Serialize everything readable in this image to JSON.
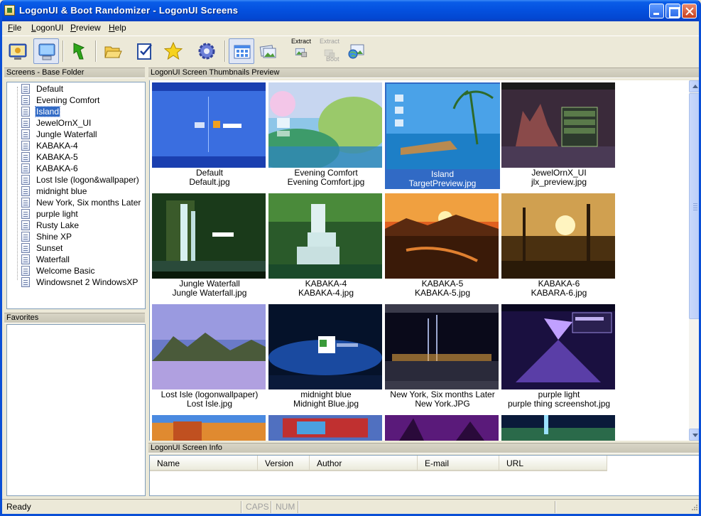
{
  "window": {
    "title": "LogonUI & Boot Randomizer - LogonUI Screens"
  },
  "menu": [
    {
      "label": "File",
      "accel": "F"
    },
    {
      "label": "LogonUI",
      "accel": "L"
    },
    {
      "label": "Preview",
      "accel": "P"
    },
    {
      "label": "Help",
      "accel": "H"
    }
  ],
  "toolbar": {
    "extract_label": "Extract",
    "extract_boot_label_1": "Extract",
    "extract_boot_label_2": "Boot"
  },
  "screens_panel": {
    "header": "Screens - Base Folder",
    "items": [
      "Default",
      "Evening Comfort",
      "Island",
      "JewelOrnX_UI",
      "Jungle Waterfall",
      "KABAKA-4",
      "KABAKA-5",
      "KABAKA-6",
      "Lost Isle (logon&wallpaper)",
      "midnight blue",
      "New York, Six months Later",
      "purple light",
      "Rusty Lake",
      "Shine XP",
      "Sunset",
      "Waterfall",
      "Welcome Basic",
      "Windowsnet 2 WindowsXP"
    ],
    "selected": "Island"
  },
  "favorites_panel": {
    "header": "Favorites"
  },
  "thumbnails_panel": {
    "header": "LogonUI Screen Thumbnails Preview",
    "items": [
      {
        "name": "Default",
        "file": "Default.jpg"
      },
      {
        "name": "Evening Comfort",
        "file": "Evening Comfort.jpg"
      },
      {
        "name": "Island",
        "file": "TargetPreview.jpg"
      },
      {
        "name": "JewelOrnX_UI",
        "file": "jlx_preview.jpg"
      },
      {
        "name": "Jungle Waterfall",
        "file": "Jungle Waterfall.jpg"
      },
      {
        "name": "KABAKA-4",
        "file": "KABAKA-4.jpg"
      },
      {
        "name": "KABAKA-5",
        "file": "KABAKA-5.jpg"
      },
      {
        "name": "KABAKA-6",
        "file": "KABARA-6.jpg"
      },
      {
        "name": "Lost Isle (logonwallpaper)",
        "file": "Lost Isle.jpg"
      },
      {
        "name": "midnight blue",
        "file": "Midnight Blue.jpg"
      },
      {
        "name": "New York, Six months Later",
        "file": "New York.JPG"
      },
      {
        "name": "purple light",
        "file": "purple thing screenshot.jpg"
      }
    ],
    "selected_index": 2
  },
  "info_panel": {
    "header": "LogonUI Screen Info",
    "columns": [
      "Name",
      "Version",
      "Author",
      "E-mail",
      "URL"
    ]
  },
  "status": {
    "text": "Ready",
    "caps": "CAPS",
    "num": "NUM"
  },
  "colors": {
    "selection": "#316ac5",
    "titlebar": "#0451df",
    "chrome": "#ece9d8"
  }
}
